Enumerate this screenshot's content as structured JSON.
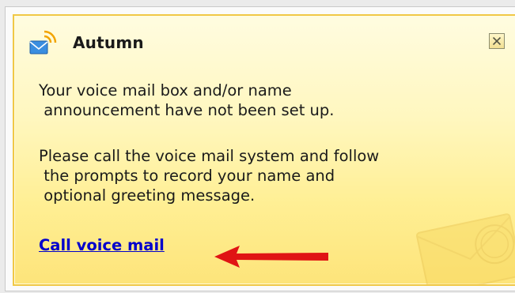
{
  "popup": {
    "title": "Autumn",
    "icon": "voicemail-notification-icon",
    "close_icon": "close-x-icon",
    "message_1": "Your voice mail box and/or name\n announcement have not been set up.",
    "message_2": "Please call the voice mail system and follow\n the prompts to record your name and\n optional greeting message.",
    "link_label": "Call voice mail",
    "arrow_color": "#e01414",
    "link_color": "#0000cc",
    "background_color": "#fff3a8",
    "border_color": "#f0c846"
  }
}
